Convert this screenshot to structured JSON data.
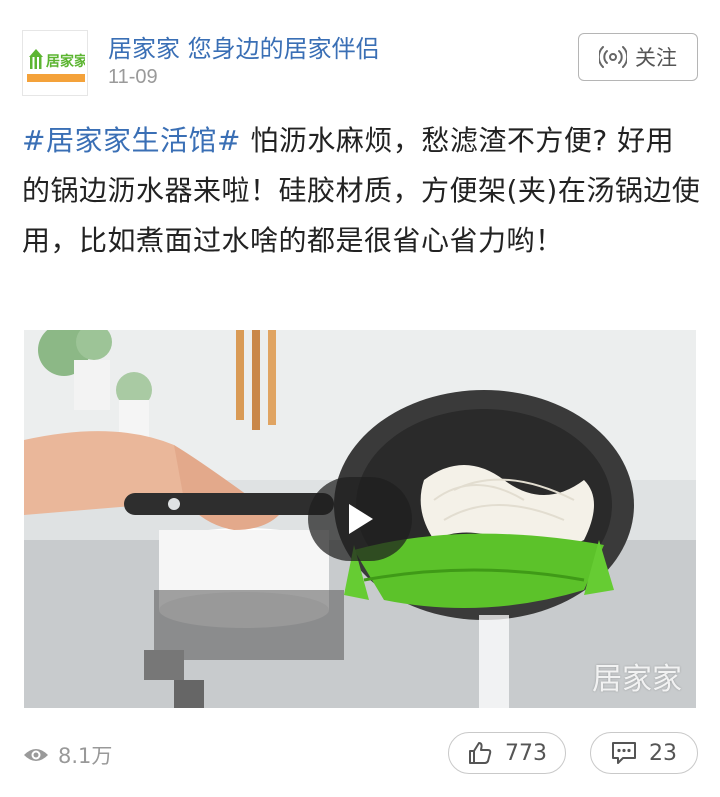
{
  "author": {
    "name": "居家家 您身边的居家伴侣",
    "avatar_logo_text": "居家家",
    "avatar_logo_subtext": "您身边的居家伴侣"
  },
  "post": {
    "date": "11-09",
    "hashtag": "#居家家生活馆#",
    "text": " 怕沥水麻烦，愁滤渣不方便? 好用的锅边沥水器来啦！硅胶材质，方便架(夹)在汤锅边使用，比如煮面过水啥的都是很省心省力哟！"
  },
  "follow": {
    "label": "关注",
    "icon": "broadcast-icon"
  },
  "video": {
    "watermark": "居家家",
    "play_icon": "play-icon"
  },
  "stats": {
    "views": "8.1万",
    "likes": "773",
    "comments": "23"
  },
  "colors": {
    "link": "#3a6fb5",
    "text": "#222222",
    "muted": "#999999",
    "strainer_green": "#5cc22a"
  }
}
